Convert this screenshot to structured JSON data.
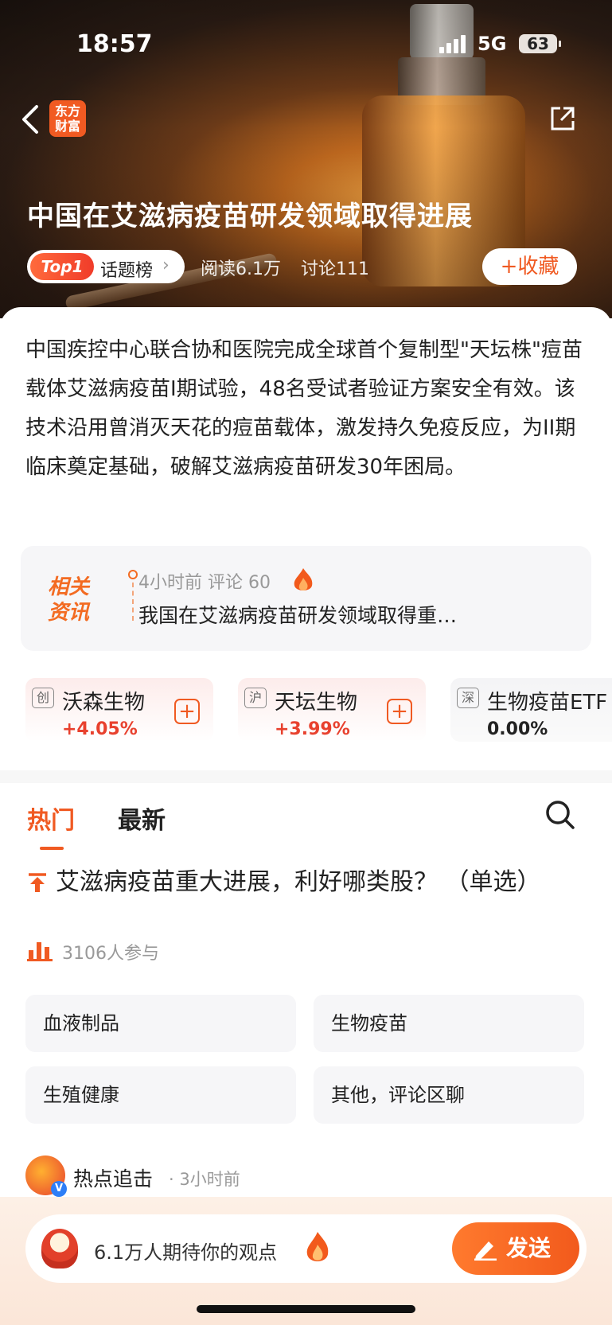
{
  "status_bar": {
    "time": "18:57",
    "network": "5G",
    "battery": "63"
  },
  "header": {
    "logo_text_line1": "东方",
    "logo_text_line2": "财富",
    "title": "中国在艾滋病疫苗研发领域取得进展"
  },
  "topic": {
    "rank_badge": "Top1",
    "board_label": "话题榜",
    "reads": "阅读6.1万",
    "discussions": "讨论111",
    "favorite_label": "+收藏"
  },
  "summary": "中国疾控中心联合协和医院完成全球首个复制型\"天坛株\"痘苗载体艾滋病疫苗I期试验，48名受试者验证方案安全有效。该技术沿用曾消灭天花的痘苗载体，激发持久免疫反应，为II期临床奠定基础，破解艾滋病疫苗研发30年困局。",
  "related": {
    "tag_line1": "相关",
    "tag_line2": "资讯",
    "meta": "4小时前  评论 60",
    "title": "我国在艾滋病疫苗研发领域取得重…"
  },
  "stocks": [
    {
      "exchange": "创",
      "name": "沃森生物",
      "change": "+4.05%"
    },
    {
      "exchange": "沪",
      "name": "天坛生物",
      "change": "+3.99%"
    },
    {
      "exchange": "深",
      "name": "生物疫苗ETF",
      "change": "0.00%"
    }
  ],
  "tabs": {
    "hot": "热门",
    "latest": "最新"
  },
  "poll": {
    "question": "艾滋病疫苗重大进展，利好哪类股？ （单选）",
    "participants": "3106人参与",
    "options": [
      "血液制品",
      "生物疫苗",
      "生殖健康",
      "其他，评论区聊"
    ]
  },
  "post": {
    "author": "热点追击",
    "time": "· 3小时前"
  },
  "bottom_bar": {
    "placeholder": "6.1万人期待你的观点",
    "send_label": "发送"
  },
  "colors": {
    "accent": "#f05a22",
    "up": "#e8412e"
  }
}
